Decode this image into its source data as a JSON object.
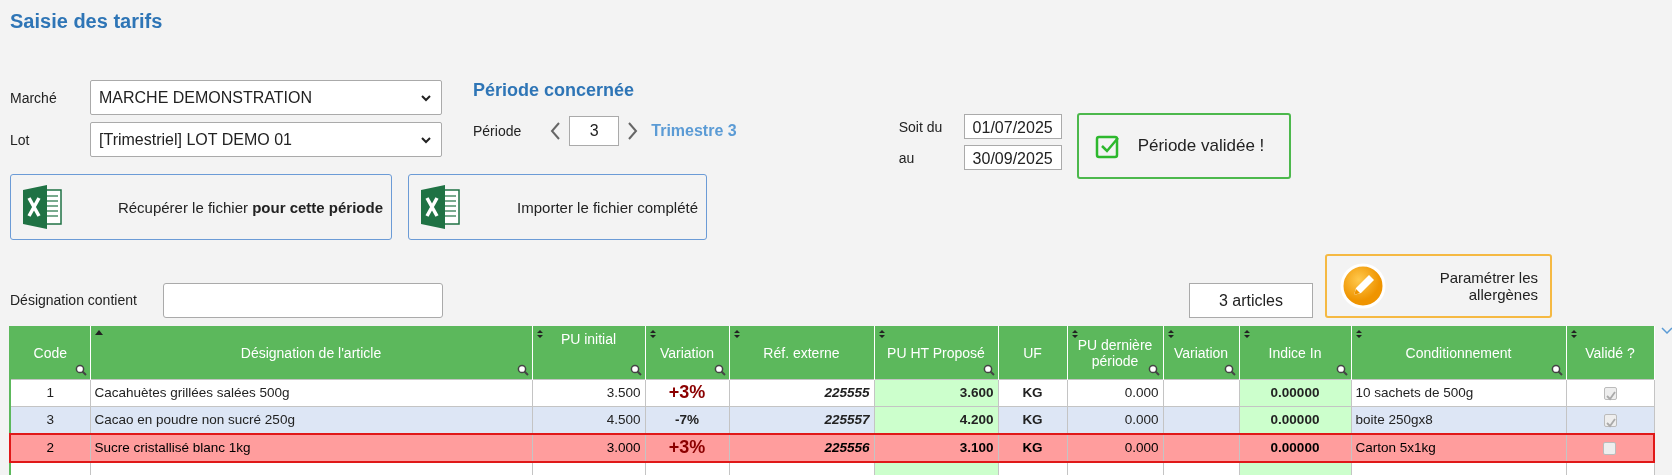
{
  "title": "Saisie des tarifs",
  "filters": [
    {
      "label": "Marché",
      "value": "MARCHE DEMONSTRATION"
    },
    {
      "label": "Lot",
      "value": "[Trimestriel] LOT DEMO 01"
    }
  ],
  "period": {
    "heading": "Période concernée",
    "label": "Période",
    "value": "3",
    "name": "Trimestre 3"
  },
  "dates": [
    {
      "label": "Soit du",
      "value": "01/07/2025"
    },
    {
      "label": "au",
      "value": "30/09/2025"
    }
  ],
  "validated": {
    "text": "Période validée !",
    "checked": true
  },
  "buttons": [
    {
      "text": "Récupérer le fichier **pour cette période**"
    },
    {
      "text": "Importer le fichier complété"
    }
  ],
  "search": {
    "label": "Désignation contient"
  },
  "count": "3 articles",
  "allergen_button": "Paramétrer les allergènes",
  "table": {
    "columns": [
      {
        "label": "Code",
        "sortable": false,
        "filter": true,
        "editable": false
      },
      {
        "label": "Désignation de l'article",
        "sortable": true,
        "sorted": true,
        "filter": true,
        "editable": false
      },
      {
        "label": "PU initial",
        "sortable": true,
        "sorted": false,
        "filter": true,
        "editable": false
      },
      {
        "label": "Variation",
        "sortable": true,
        "sorted": false,
        "filter": true,
        "editable": false
      },
      {
        "label": "Réf. externe",
        "sortable": true,
        "sorted": false,
        "filter": false,
        "editable": false
      },
      {
        "label": "PU HT Proposé",
        "sortable": true,
        "sorted": false,
        "filter": true,
        "editable": true
      },
      {
        "label": "UF",
        "sortable": false,
        "filter": false,
        "editable": false
      },
      {
        "label": "PU dernière période",
        "sortable": true,
        "sorted": false,
        "filter": true,
        "editable": false
      },
      {
        "label": "Variation",
        "sortable": true,
        "sorted": false,
        "filter": true,
        "editable": false
      },
      {
        "label": "Indice In",
        "sortable": true,
        "sorted": false,
        "filter": true,
        "editable": true
      },
      {
        "label": "Conditionnement",
        "sortable": true,
        "sorted": false,
        "filter": true,
        "editable": false
      },
      {
        "label": "Validé ?",
        "sortable": true,
        "sorted": false,
        "filter": false,
        "editable": false
      }
    ],
    "rows": [
      {
        "code": "1",
        "name": "Cacahuètes grillées salées 500g",
        "pu_initial": "3.500",
        "variation": {
          "text": "+3%",
          "emphasized": true
        },
        "ref": "225555",
        "pu_ht": "3.600",
        "uf": "KG",
        "pu_last": "0.000",
        "index": "0.00000",
        "packaging": "10 sachets de 500g",
        "validated": true,
        "invalid": false
      },
      {
        "code": "3",
        "name": "Cacao en poudre non sucré 250g",
        "pu_initial": "4.500",
        "variation": {
          "text": "-7%",
          "emphasized": false
        },
        "ref": "225557",
        "pu_ht": "4.200",
        "uf": "KG",
        "pu_last": "0.000",
        "index": "0.00000",
        "packaging": "boite 250gx8",
        "validated": true,
        "invalid": false
      },
      {
        "code": "2",
        "name": "Sucre cristallisé blanc 1kg",
        "pu_initial": "3.000",
        "variation": {
          "text": "+3%",
          "emphasized": true
        },
        "ref": "225556",
        "pu_ht": "3.100",
        "uf": "KG",
        "pu_last": "0.000",
        "index": "0.00000",
        "packaging": "Carton 5x1kg",
        "validated": false,
        "invalid": true
      }
    ]
  }
}
